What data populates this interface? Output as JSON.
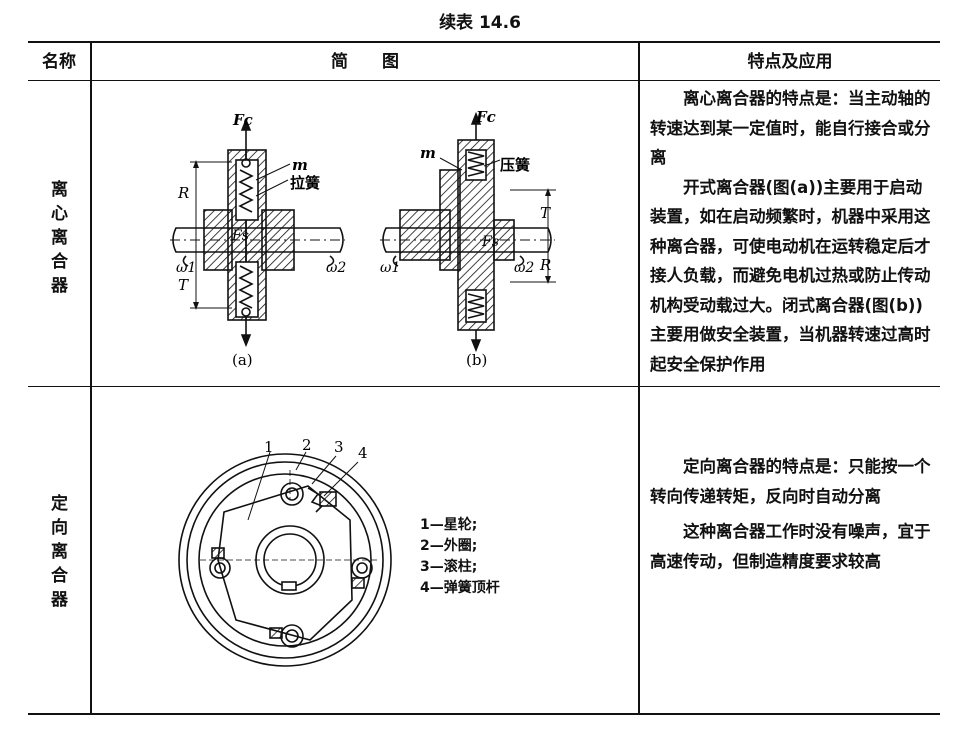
{
  "caption": "续表 14.6",
  "headers": {
    "name": "名称",
    "diagram": "简　　图",
    "features": "特点及应用"
  },
  "rows": [
    {
      "name": "离心离合器",
      "description": [
        "离心离合器的特点是：当主动轴的转速达到某一定值时，能自行接合或分离",
        "开式离合器(图(a))主要用于启动装置，如在启动频繁时，机器中采用这种离合器，可使电动机在运转稳定后才接人负载，而避免电机过热或防止传动机构受动载过大。闭式离合器(图(b))主要用做安全装置，当机器转速过高时起安全保护作用"
      ],
      "figure_labels": {
        "fc_a": "Fc",
        "fc_b": "Fc",
        "m_a": "m",
        "m_b": "m",
        "spring_a": "拉簧",
        "spring_b": "压簧",
        "fs_a": "Fs",
        "fs_b": "Fs",
        "r_a": "R",
        "t_a": "T",
        "r_b": "R",
        "t_b": "T",
        "w1_a": "ω1",
        "w2_a": "ω2",
        "w1_b": "ω1",
        "w2_b": "ω2",
        "cap_a": "(a)",
        "cap_b": "(b)"
      }
    },
    {
      "name": "定向离合器",
      "description": [
        "定向离合器的特点是：只能按一个转向传递转矩，反向时自动分离",
        "这种离合器工作时没有噪声，宜于高速传动，但制造精度要求较高"
      ],
      "figure_labels": {
        "n1": "1",
        "n2": "2",
        "n3": "3",
        "n4": "4"
      },
      "legend": [
        "1—星轮;",
        "2—外圈;",
        "3—滚柱;",
        "4—弹簧顶杆"
      ]
    }
  ]
}
